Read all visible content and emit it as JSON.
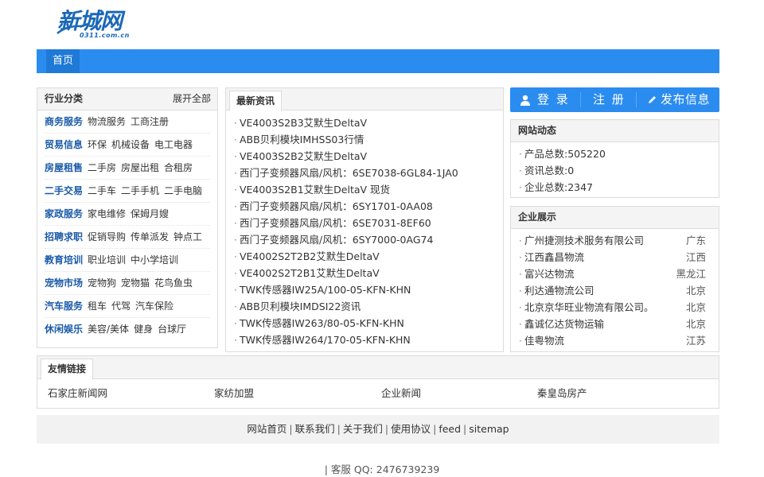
{
  "logo": {
    "main": "新城网",
    "sub": "0311.com.cn"
  },
  "nav": {
    "home": "首页"
  },
  "categories": {
    "title": "行业分类",
    "expand": "展开全部",
    "rows": [
      {
        "head": "商务服务",
        "subs": [
          "物流服务",
          "工商注册"
        ]
      },
      {
        "head": "贸易信息",
        "subs": [
          "环保",
          "机械设备",
          "电工电器"
        ]
      },
      {
        "head": "房屋租售",
        "subs": [
          "二手房",
          "房屋出租",
          "合租房"
        ]
      },
      {
        "head": "二手交易",
        "subs": [
          "二手车",
          "二手手机",
          "二手电脑"
        ]
      },
      {
        "head": "家政服务",
        "subs": [
          "家电维修",
          "保姆月嫂"
        ]
      },
      {
        "head": "招聘求职",
        "subs": [
          "促销导购",
          "传单派发",
          "钟点工"
        ]
      },
      {
        "head": "教育培训",
        "subs": [
          "职业培训",
          "中小学培训"
        ]
      },
      {
        "head": "宠物市场",
        "subs": [
          "宠物狗",
          "宠物猫",
          "花鸟鱼虫"
        ]
      },
      {
        "head": "汽车服务",
        "subs": [
          "租车",
          "代驾",
          "汽车保险"
        ]
      },
      {
        "head": "休闲娱乐",
        "subs": [
          "美容/美体",
          "健身",
          "台球厅"
        ]
      }
    ]
  },
  "news": {
    "tab": "最新资讯",
    "bullet": "·",
    "items": [
      "VE4003S2B3艾默生DeltaV",
      "ABB贝利模块IMHSS03行情",
      "VE4003S2B2艾默生DeltaV",
      "西门子变频器风扇/风机：6SE7038-6GL84-1JA0",
      "VE4003S2B1艾默生DeltaV 现货",
      "西门子变频器风扇/风机：6SY1701-0AA08",
      "西门子变频器风扇/风机：6SE7031-8EF60",
      "西门子变频器风扇/风机：6SY7000-0AG74",
      "VE4002S2T2B2艾默生DeltaV",
      "VE4002S2T2B1艾默生DeltaV",
      "TWK传感器IW25A/100-05-KFN-KHN",
      "ABB贝利模块IMDSI22资讯",
      "TWK传感器IW263/80-05-KFN-KHN",
      "TWK传感器IW264/170-05-KFN-KHN"
    ]
  },
  "actions": {
    "login": "登 录",
    "register": "注 册",
    "publish": "发布信息"
  },
  "stats": {
    "title": "网站动态",
    "items": [
      "产品总数:505220",
      "资讯总数:0",
      "企业总数:2347"
    ]
  },
  "companies": {
    "title": "企业展示",
    "items": [
      {
        "name": "广州捷测技术服务有限公司",
        "loc": "广东"
      },
      {
        "name": "江西鑫昌物流",
        "loc": "江西"
      },
      {
        "name": "富兴达物流",
        "loc": "黑龙江"
      },
      {
        "name": "利达通物流公司",
        "loc": "北京"
      },
      {
        "name": "北京京华旺业物流有限公司。",
        "loc": "北京"
      },
      {
        "name": "鑫诚亿达货物运输",
        "loc": "北京"
      },
      {
        "name": "佳粤物流",
        "loc": "江苏"
      }
    ]
  },
  "friends": {
    "title": "友情链接",
    "links": [
      "石家庄新闻网",
      "家纺加盟",
      "企业新闻",
      "秦皇岛房产"
    ]
  },
  "footer": {
    "links": [
      "网站首页",
      "联系我们",
      "关于我们",
      "使用协议",
      "feed",
      "sitemap"
    ],
    "separator": "|",
    "service": "| 客服 QQ:  2476739239"
  },
  "colors": {
    "accent": "#2b8cf0",
    "brand": "#1a68b8",
    "category": "#1a5aa8"
  }
}
